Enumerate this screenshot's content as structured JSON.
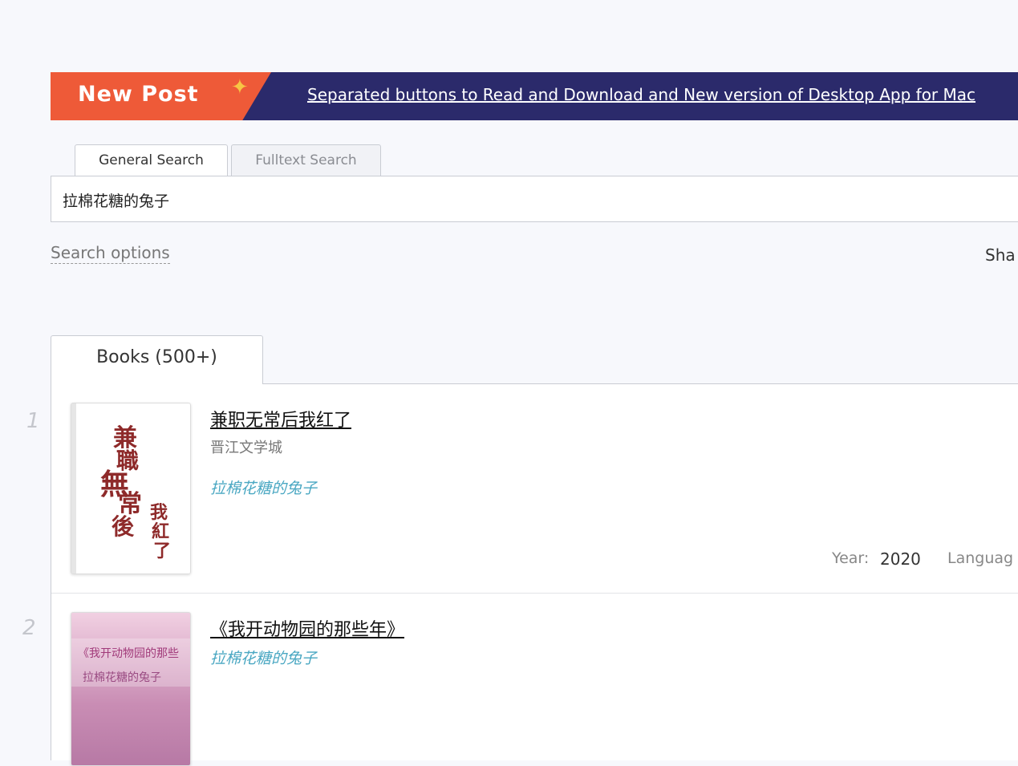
{
  "banner": {
    "badge": "New Post",
    "link": "Separated buttons to Read and Download and New version of Desktop App for Mac"
  },
  "search": {
    "tabs": [
      "General Search",
      "Fulltext Search"
    ],
    "query": "拉棉花糖的兔子",
    "options_label": "Search options",
    "share_label": "Sha"
  },
  "results": {
    "tab_label": "Books (500+)",
    "items": [
      {
        "num": "1",
        "title": "兼职无常后我红了",
        "publisher": "晋江文学城",
        "author": "拉棉花糖的兔子",
        "year_label": "Year:",
        "year": "2020",
        "language_label": "Languag"
      },
      {
        "num": "2",
        "title": "《我开动物园的那些年》",
        "author": "拉棉花糖的兔子",
        "cover_title": "《我开动物园的那些",
        "cover_author": "拉棉花糖的兔子"
      }
    ]
  },
  "colors": {
    "banner_bg": "#2b2a6b",
    "badge_bg": "#ee5a38",
    "author_link": "#49a7c2"
  }
}
